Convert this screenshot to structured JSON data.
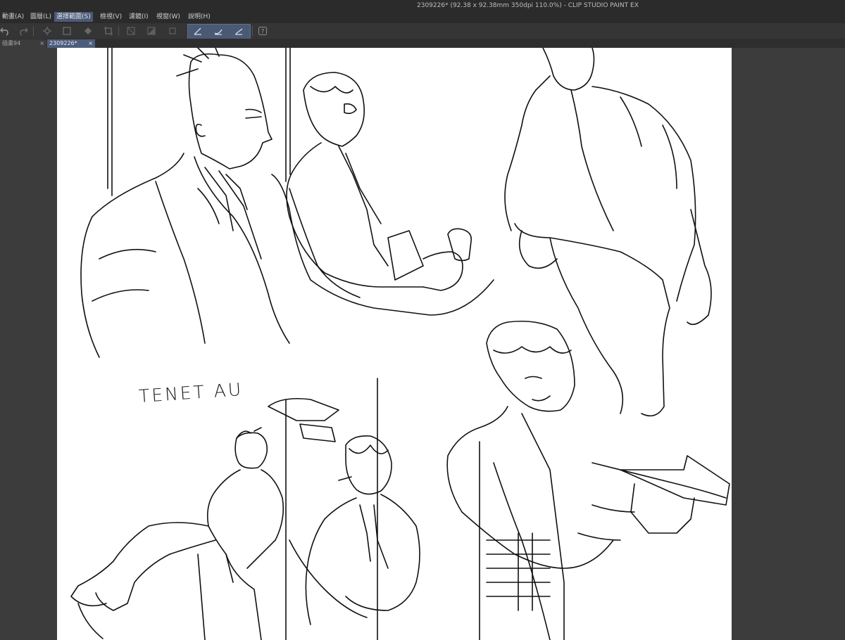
{
  "window": {
    "title": "2309226* (92.38 x 92.38mm 350dpi 110.0%)  - CLIP STUDIO PAINT EX"
  },
  "menu": {
    "items": [
      "動畫(A)",
      "圖層(L)",
      "選擇範圍(S)",
      "檢視(V)",
      "濾鏡(I)",
      "視窗(W)",
      "說明(H)"
    ],
    "active_index": 2
  },
  "toolbar": {
    "icons": [
      "undo-icon",
      "redo-icon",
      "settings-icon",
      "transform-icon",
      "fill-icon",
      "crop-icon",
      "layer-clip-icon",
      "tone-icon",
      "frame-icon",
      "pen-a-icon",
      "pen-b-icon",
      "pen-c-icon",
      "help-icon"
    ]
  },
  "tabs": [
    {
      "label": "插畫94",
      "close": "×",
      "active": false
    },
    {
      "label": "2309226*",
      "close": "×",
      "active": true
    }
  ],
  "canvas": {
    "annotation": "TENET AU",
    "background": "#ffffff"
  },
  "colors": {
    "ui_dark": "#2b2b2b",
    "accent": "#4c5d7c",
    "canvas_border": "#3c3c3c"
  }
}
